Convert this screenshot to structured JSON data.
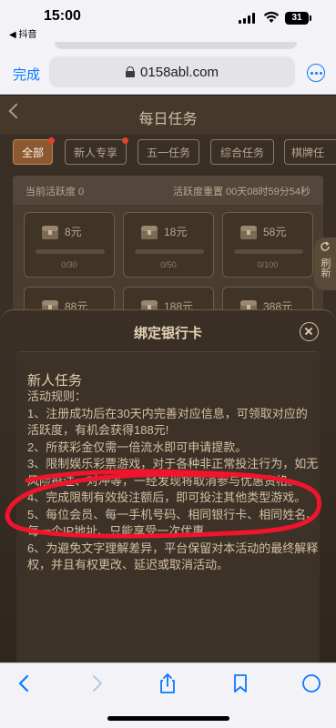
{
  "status_bar": {
    "time": "15:00",
    "back_app": "◀ 抖音",
    "battery": "31"
  },
  "browser": {
    "done_label": "完成",
    "url": "0158abl.com"
  },
  "page": {
    "title": "每日任务",
    "tabs": [
      {
        "label": "全部",
        "active": true,
        "badge": true
      },
      {
        "label": "新人专享",
        "active": false,
        "badge": true
      },
      {
        "label": "五一任务",
        "active": false,
        "badge": false
      },
      {
        "label": "综合任务",
        "active": false,
        "badge": false
      },
      {
        "label": "棋牌任",
        "active": false,
        "badge": false
      }
    ],
    "activity_current": "当前活跃度 0",
    "activity_reset": "活跃度重置 00天08时59分54秒",
    "refresh_label": "刷新",
    "cards": [
      {
        "amount": "8元",
        "progress": "0/30",
        "fraction": 0
      },
      {
        "amount": "18元",
        "progress": "0/50",
        "fraction": 0
      },
      {
        "amount": "58元",
        "progress": "0/100",
        "fraction": 0
      },
      {
        "amount": "88元",
        "progress": "",
        "fraction": 0
      },
      {
        "amount": "188元",
        "progress": "",
        "fraction": 0
      },
      {
        "amount": "388元",
        "progress": "",
        "fraction": 0
      }
    ]
  },
  "modal": {
    "title": "绑定银行卡",
    "section_title": "新人任务",
    "rules": [
      "活动规则：",
      "1、注册成功后在30天内完善对应信息，可领取对应的活跃度，有机会获得188元!",
      "2、所获彩金仅需一倍流水即可申请提款。",
      "3、限制娱乐彩票游戏，对于各种非正常投注行为，如无风险投注、对冲等，一经发现将取消参与优惠资格。",
      "4、完成限制有效投注额后，即可投注其他类型游戏。",
      "5、每位会员、每一手机号码、相同银行卡、相同姓名、每一个IP地址、只能享受一次优惠。",
      "6、为避免文字理解差异，平台保留对本活动的最终解释权，并且有权更改、延迟或取消活动。"
    ]
  },
  "colors": {
    "accent": "#0a7aff",
    "annotation_red": "#f0142c",
    "gold_text": "#d3c1a5"
  }
}
